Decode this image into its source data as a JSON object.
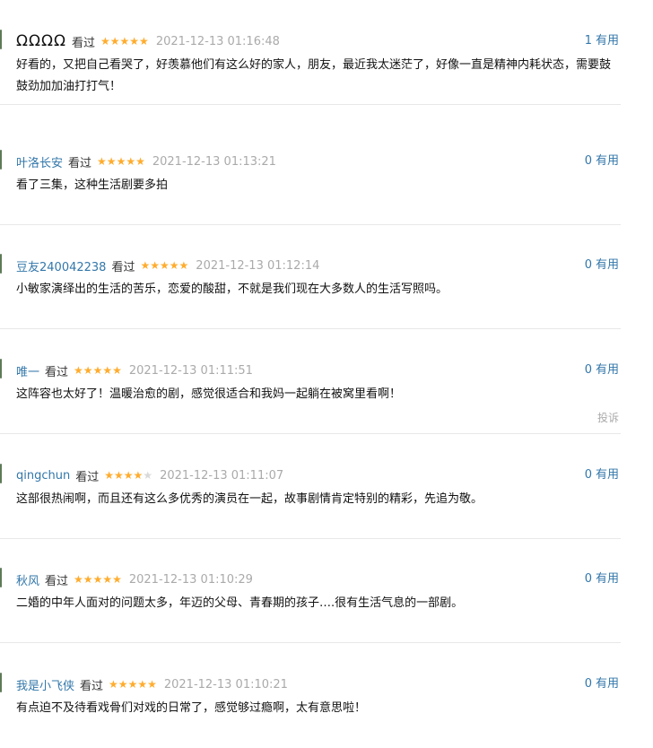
{
  "comments": [
    {
      "user": "ΩΩΩΩ",
      "user_is_glyphs": true,
      "status": "看过",
      "stars": 5,
      "time": "2021-12-13 01:16:48",
      "votes": "1",
      "useful_label": "有用",
      "content": "好看的，又把自己看哭了，好羡慕他们有这么好的家人，朋友，最近我太迷茫了，好像一直是精神内耗状态，需要鼓鼓劲加加油打打气！"
    },
    {
      "user": "叶洛长安",
      "status": "看过",
      "stars": 5,
      "time": "2021-12-13 01:13:21",
      "votes": "0",
      "useful_label": "有用",
      "content": "看了三集，这种生活剧要多拍"
    },
    {
      "user": "豆友240042238",
      "status": "看过",
      "stars": 5,
      "time": "2021-12-13 01:12:14",
      "votes": "0",
      "useful_label": "有用",
      "content": "小敏家演绎出的生活的苦乐，恋爱的酸甜，不就是我们现在大多数人的生活写照吗。"
    },
    {
      "user": "唯一",
      "status": "看过",
      "stars": 5,
      "time": "2021-12-13 01:11:51",
      "votes": "0",
      "useful_label": "有用",
      "content": "这阵容也太好了！温暖治愈的剧，感觉很适合和我妈一起躺在被窝里看啊！",
      "report": "投诉"
    },
    {
      "user": "qingchun",
      "status": "看过",
      "stars": 4,
      "time": "2021-12-13 01:11:07",
      "votes": "0",
      "useful_label": "有用",
      "content": "这部很热闹啊，而且还有这么多优秀的演员在一起，故事剧情肯定特别的精彩，先追为敬。"
    },
    {
      "user": "秋风",
      "status": "看过",
      "stars": 5,
      "time": "2021-12-13 01:10:29",
      "votes": "0",
      "useful_label": "有用",
      "content": "二婚的中年人面对的问题太多，年迈的父母、青春期的孩子….很有生活气息的一部剧。"
    },
    {
      "user": "我是小飞侠",
      "status": "看过",
      "stars": 5,
      "time": "2021-12-13 01:10:21",
      "votes": "0",
      "useful_label": "有用",
      "content": "有点迫不及待看戏骨们对戏的日常了，感觉够过瘾啊，太有意思啦！"
    }
  ],
  "colors": {
    "link": "#3377aa",
    "star_on": "#ffac2d",
    "star_off": "#d9d9d9",
    "time": "#aaaaaa"
  },
  "icons": {
    "star": "star-icon"
  }
}
